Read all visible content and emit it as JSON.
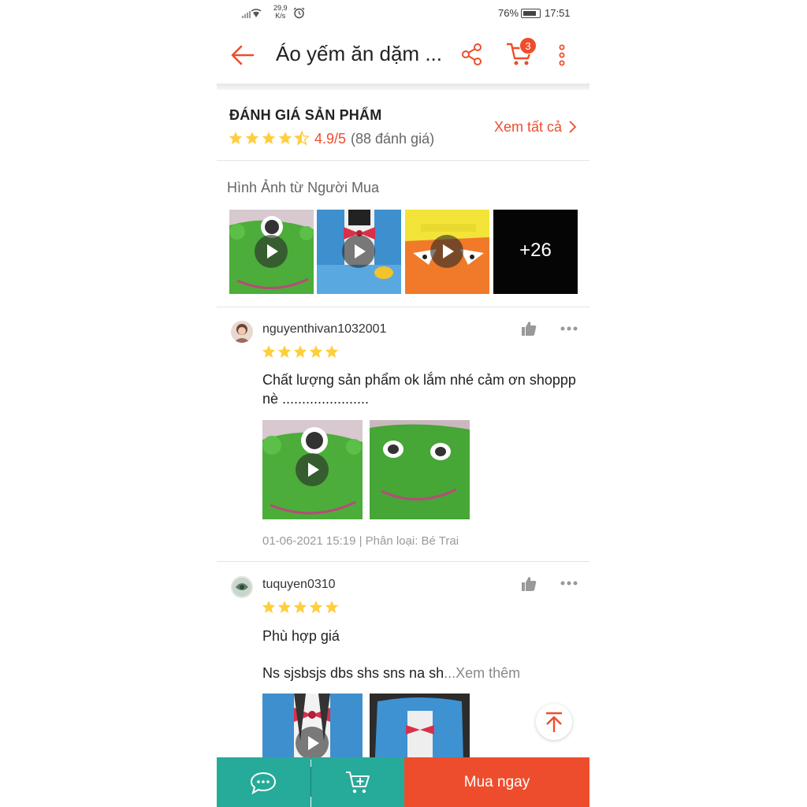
{
  "status_bar": {
    "net_speed_value": "29,9",
    "net_speed_unit": "K/s",
    "battery": "76%",
    "time": "17:51"
  },
  "header": {
    "title": "Áo yếm ăn dặm ...",
    "cart_badge": "3"
  },
  "rating": {
    "heading": "ĐÁNH GIÁ SẢN PHẨM",
    "score": "4.9/5",
    "count": "(88 đánh giá)",
    "view_all": "Xem tất cả",
    "stars": 4.5
  },
  "buyer_pics": {
    "title": "Hình Ảnh từ Người Mua",
    "more_count": "+26"
  },
  "reviews": [
    {
      "username": "nguyenthivan1032001",
      "stars": 5,
      "text": "Chất lượng sản phẩm ok lắm nhé cảm ơn shoppp nè ......................",
      "meta": "01-06-2021 15:19 | Phân loại: Bé Trai"
    },
    {
      "username": "tuquyen0310",
      "stars": 5,
      "text_line1": "Phù hợp giá",
      "text_line2": "Ns sjsbsjs dbs shs sns na sh",
      "see_more": "...Xem thêm"
    }
  ],
  "bottom_bar": {
    "buy_now": "Mua ngay"
  },
  "colors": {
    "brand": "#ee4d2d",
    "teal": "#26aa99",
    "star": "#ffce3d"
  }
}
